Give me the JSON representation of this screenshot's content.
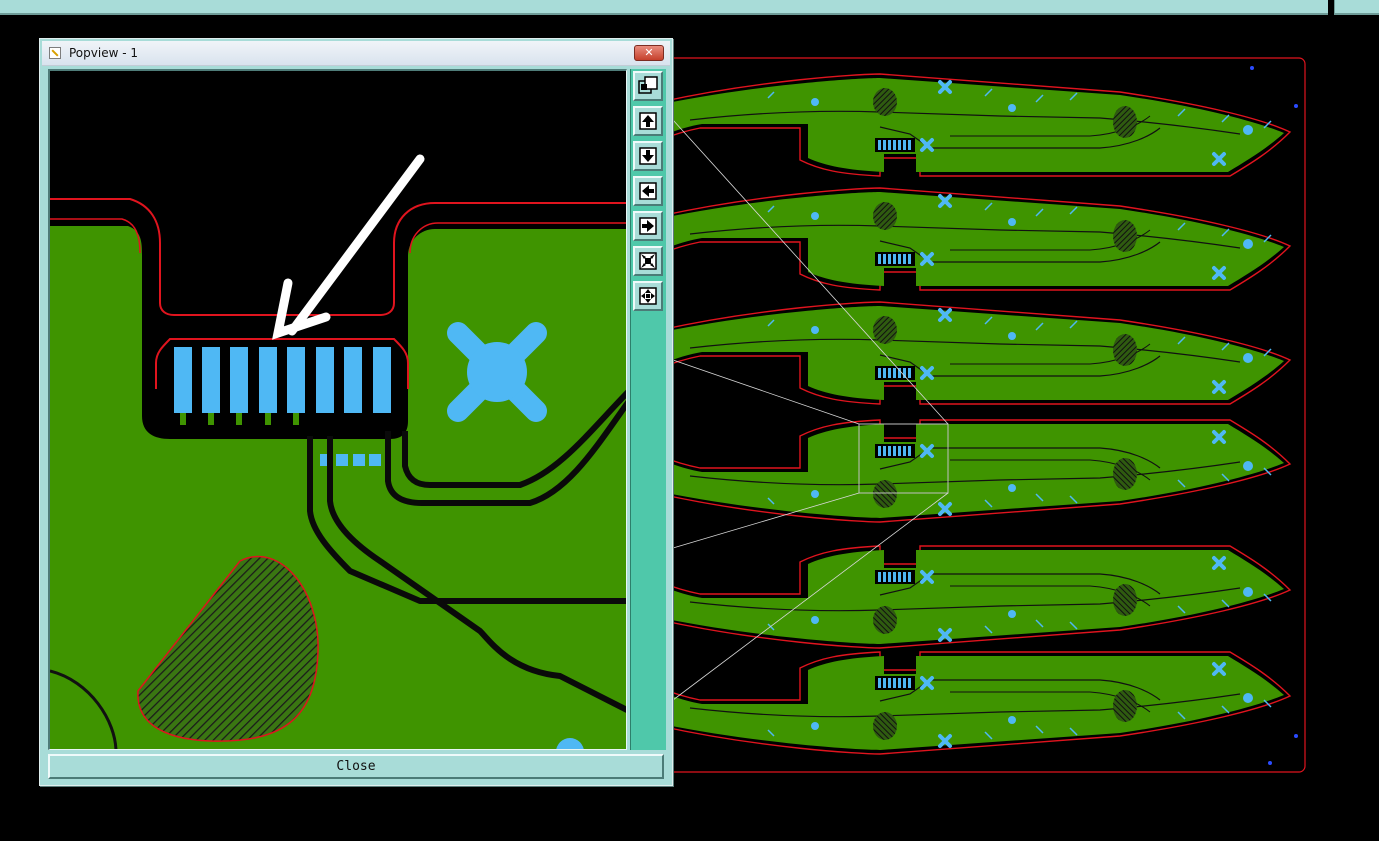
{
  "popup": {
    "title": "Popview - 1",
    "close_label": "Close",
    "toolbar": [
      {
        "name": "zoom-fit-icon"
      },
      {
        "name": "pan-up-icon"
      },
      {
        "name": "pan-down-icon"
      },
      {
        "name": "pan-left-icon"
      },
      {
        "name": "pan-right-icon"
      },
      {
        "name": "zoom-in-icon"
      },
      {
        "name": "zoom-out-icon"
      }
    ]
  },
  "colors": {
    "background": "#000000",
    "board_copper": "#3f9400",
    "outline": "#e0141e",
    "pad": "#4fb8f4",
    "ui_panel": "#a8dcd8",
    "toolstrip": "#4fc8aa"
  },
  "panel_count": 6
}
